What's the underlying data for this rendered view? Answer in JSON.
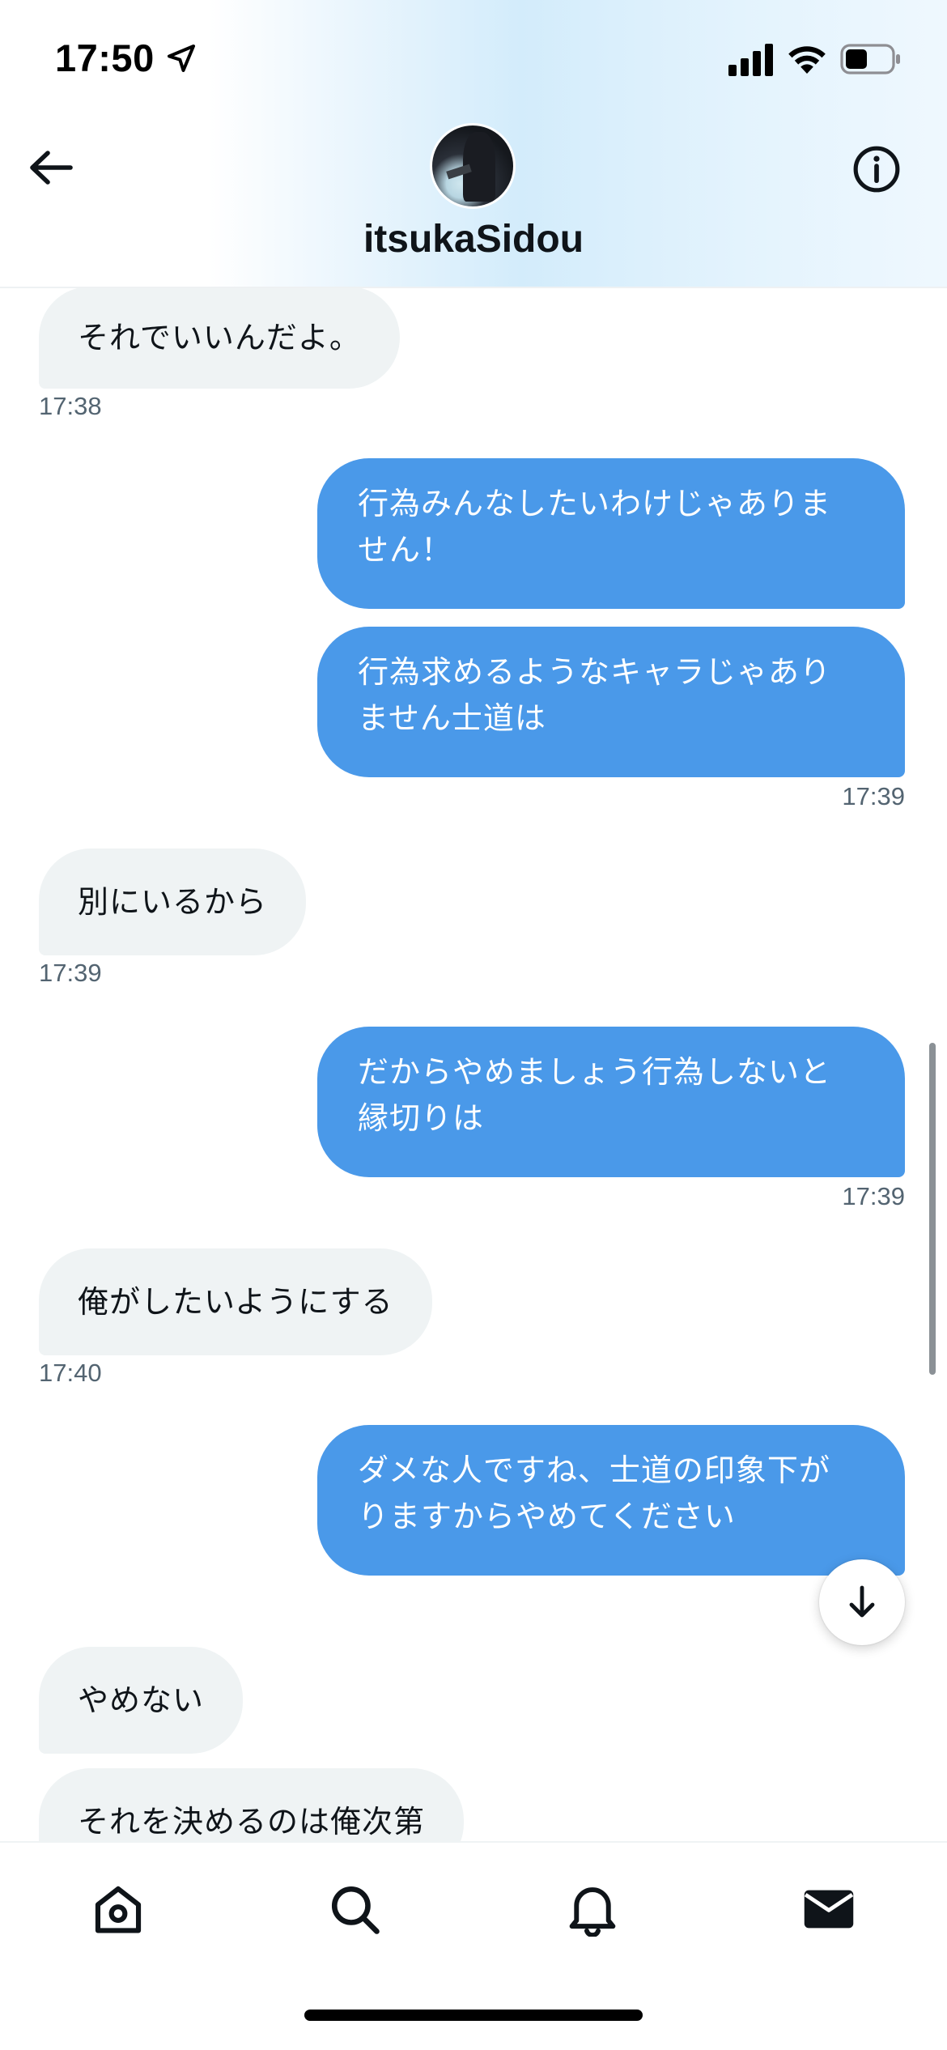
{
  "status_bar": {
    "time": "17:50"
  },
  "header": {
    "contact_name": "itsukaSidou"
  },
  "messages": [
    {
      "dir": "in",
      "text": "それでいいんだよ。",
      "time": "17:38"
    },
    {
      "dir": "out",
      "text": "行為みんなしたいわけじゃありま\nせん！",
      "time": ""
    },
    {
      "dir": "out",
      "text": "行為求めるようなキャラじゃあり\nません士道は",
      "time": "17:39"
    },
    {
      "dir": "in",
      "text": "別にいるから",
      "time": "17:39"
    },
    {
      "dir": "out",
      "text": "だからやめましょう行為しないと\n縁切りは",
      "time": "17:39"
    },
    {
      "dir": "in",
      "text": "俺がしたいようにする",
      "time": "17:40"
    },
    {
      "dir": "out",
      "text": "ダメな人ですね、士道の印象下が\nりますからやめてください",
      "time": ""
    },
    {
      "dir": "in",
      "text": "やめない",
      "time": ""
    },
    {
      "dir": "in",
      "text": "それを決めるのは俺次第",
      "time": ""
    }
  ],
  "icons": {
    "back": "arrow-left-icon",
    "info": "info-icon",
    "scroll_down": "arrow-down-icon",
    "tabs": [
      "home-icon",
      "search-icon",
      "bell-icon",
      "mail-icon"
    ]
  },
  "colors": {
    "outgoing_bubble": "#4a99e9",
    "incoming_bubble": "#eff3f4",
    "timestamp": "#536471"
  }
}
